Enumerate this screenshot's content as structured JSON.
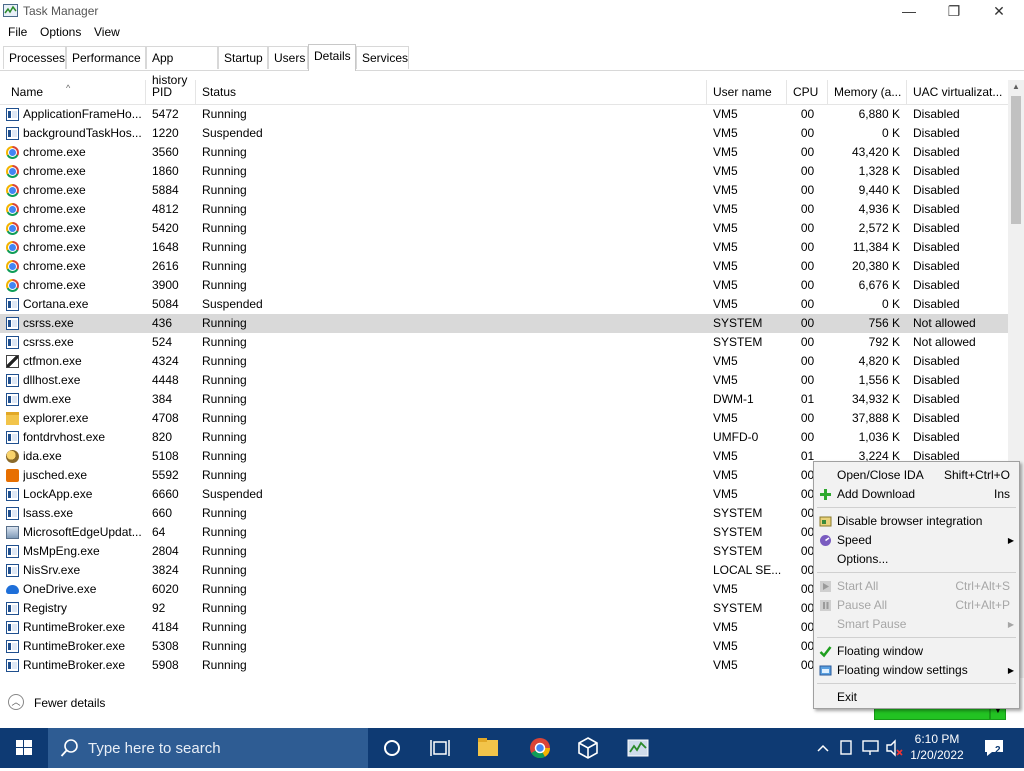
{
  "window": {
    "title": "Task Manager",
    "controls": {
      "minimize": "—",
      "restore": "❐",
      "close": "✕"
    }
  },
  "menu": [
    "File",
    "Options",
    "View"
  ],
  "tabs": [
    "Processes",
    "Performance",
    "App history",
    "Startup",
    "Users",
    "Details",
    "Services"
  ],
  "active_tab": "Details",
  "table": {
    "columns": [
      "Name",
      "PID",
      "Status",
      "User name",
      "CPU",
      "Memory (a...",
      "UAC virtualizat..."
    ],
    "selected_row": 11,
    "rows": [
      {
        "icon": "app-window-icon",
        "name": "ApplicationFrameHo...",
        "pid": "5472",
        "status": "Running",
        "user": "VM5",
        "cpu": "00",
        "mem": "6,880 K",
        "uac": "Disabled"
      },
      {
        "icon": "app-window-icon",
        "name": "backgroundTaskHos...",
        "pid": "1220",
        "status": "Suspended",
        "user": "VM5",
        "cpu": "00",
        "mem": "0 K",
        "uac": "Disabled"
      },
      {
        "icon": "chrome-icon",
        "name": "chrome.exe",
        "pid": "3560",
        "status": "Running",
        "user": "VM5",
        "cpu": "00",
        "mem": "43,420 K",
        "uac": "Disabled"
      },
      {
        "icon": "chrome-icon",
        "name": "chrome.exe",
        "pid": "1860",
        "status": "Running",
        "user": "VM5",
        "cpu": "00",
        "mem": "1,328 K",
        "uac": "Disabled"
      },
      {
        "icon": "chrome-icon",
        "name": "chrome.exe",
        "pid": "5884",
        "status": "Running",
        "user": "VM5",
        "cpu": "00",
        "mem": "9,440 K",
        "uac": "Disabled"
      },
      {
        "icon": "chrome-icon",
        "name": "chrome.exe",
        "pid": "4812",
        "status": "Running",
        "user": "VM5",
        "cpu": "00",
        "mem": "4,936 K",
        "uac": "Disabled"
      },
      {
        "icon": "chrome-icon",
        "name": "chrome.exe",
        "pid": "5420",
        "status": "Running",
        "user": "VM5",
        "cpu": "00",
        "mem": "2,572 K",
        "uac": "Disabled"
      },
      {
        "icon": "chrome-icon",
        "name": "chrome.exe",
        "pid": "1648",
        "status": "Running",
        "user": "VM5",
        "cpu": "00",
        "mem": "11,384 K",
        "uac": "Disabled"
      },
      {
        "icon": "chrome-icon",
        "name": "chrome.exe",
        "pid": "2616",
        "status": "Running",
        "user": "VM5",
        "cpu": "00",
        "mem": "20,380 K",
        "uac": "Disabled"
      },
      {
        "icon": "chrome-icon",
        "name": "chrome.exe",
        "pid": "3900",
        "status": "Running",
        "user": "VM5",
        "cpu": "00",
        "mem": "6,676 K",
        "uac": "Disabled"
      },
      {
        "icon": "app-window-icon",
        "name": "Cortana.exe",
        "pid": "5084",
        "status": "Suspended",
        "user": "VM5",
        "cpu": "00",
        "mem": "0 K",
        "uac": "Disabled"
      },
      {
        "icon": "app-window-icon",
        "name": "csrss.exe",
        "pid": "436",
        "status": "Running",
        "user": "SYSTEM",
        "cpu": "00",
        "mem": "756 K",
        "uac": "Not allowed"
      },
      {
        "icon": "app-window-icon",
        "name": "csrss.exe",
        "pid": "524",
        "status": "Running",
        "user": "SYSTEM",
        "cpu": "00",
        "mem": "792 K",
        "uac": "Not allowed"
      },
      {
        "icon": "pen-icon",
        "name": "ctfmon.exe",
        "pid": "4324",
        "status": "Running",
        "user": "VM5",
        "cpu": "00",
        "mem": "4,820 K",
        "uac": "Disabled"
      },
      {
        "icon": "app-window-icon",
        "name": "dllhost.exe",
        "pid": "4448",
        "status": "Running",
        "user": "VM5",
        "cpu": "00",
        "mem": "1,556 K",
        "uac": "Disabled"
      },
      {
        "icon": "app-window-icon",
        "name": "dwm.exe",
        "pid": "384",
        "status": "Running",
        "user": "DWM-1",
        "cpu": "01",
        "mem": "34,932 K",
        "uac": "Disabled"
      },
      {
        "icon": "folder-icon",
        "name": "explorer.exe",
        "pid": "4708",
        "status": "Running",
        "user": "VM5",
        "cpu": "00",
        "mem": "37,888 K",
        "uac": "Disabled"
      },
      {
        "icon": "app-window-icon",
        "name": "fontdrvhost.exe",
        "pid": "820",
        "status": "Running",
        "user": "UMFD-0",
        "cpu": "00",
        "mem": "1,036 K",
        "uac": "Disabled"
      },
      {
        "icon": "ida-icon",
        "name": "ida.exe",
        "pid": "5108",
        "status": "Running",
        "user": "VM5",
        "cpu": "01",
        "mem": "3,224 K",
        "uac": "Disabled"
      },
      {
        "icon": "java-icon",
        "name": "jusched.exe",
        "pid": "5592",
        "status": "Running",
        "user": "VM5",
        "cpu": "00",
        "mem": "",
        "uac": ""
      },
      {
        "icon": "app-window-icon",
        "name": "LockApp.exe",
        "pid": "6660",
        "status": "Suspended",
        "user": "VM5",
        "cpu": "00",
        "mem": "",
        "uac": ""
      },
      {
        "icon": "app-window-icon",
        "name": "lsass.exe",
        "pid": "660",
        "status": "Running",
        "user": "SYSTEM",
        "cpu": "00",
        "mem": "",
        "uac": ""
      },
      {
        "icon": "edge-update-icon",
        "name": "MicrosoftEdgeUpdat...",
        "pid": "64",
        "status": "Running",
        "user": "SYSTEM",
        "cpu": "00",
        "mem": "",
        "uac": ""
      },
      {
        "icon": "app-window-icon",
        "name": "MsMpEng.exe",
        "pid": "2804",
        "status": "Running",
        "user": "SYSTEM",
        "cpu": "00",
        "mem": "",
        "uac": ""
      },
      {
        "icon": "app-window-icon",
        "name": "NisSrv.exe",
        "pid": "3824",
        "status": "Running",
        "user": "LOCAL SE...",
        "cpu": "00",
        "mem": "",
        "uac": ""
      },
      {
        "icon": "onedrive-icon",
        "name": "OneDrive.exe",
        "pid": "6020",
        "status": "Running",
        "user": "VM5",
        "cpu": "00",
        "mem": "",
        "uac": ""
      },
      {
        "icon": "app-window-icon",
        "name": "Registry",
        "pid": "92",
        "status": "Running",
        "user": "SYSTEM",
        "cpu": "00",
        "mem": "",
        "uac": ""
      },
      {
        "icon": "app-window-icon",
        "name": "RuntimeBroker.exe",
        "pid": "4184",
        "status": "Running",
        "user": "VM5",
        "cpu": "00",
        "mem": "",
        "uac": ""
      },
      {
        "icon": "app-window-icon",
        "name": "RuntimeBroker.exe",
        "pid": "5308",
        "status": "Running",
        "user": "VM5",
        "cpu": "00",
        "mem": "",
        "uac": ""
      },
      {
        "icon": "app-window-icon",
        "name": "RuntimeBroker.exe",
        "pid": "5908",
        "status": "Running",
        "user": "VM5",
        "cpu": "00",
        "mem": "",
        "uac": ""
      }
    ]
  },
  "footer": {
    "fewer_details": "Fewer details"
  },
  "context_menu": {
    "items": [
      {
        "label": "Open/Close IDA",
        "shortcut": "Shift+Ctrl+O",
        "icon": "",
        "disabled": false,
        "submenu": false
      },
      {
        "label": "Add Download",
        "shortcut": "Ins",
        "icon": "add-download-icon",
        "disabled": false,
        "submenu": false
      },
      {
        "separator": true
      },
      {
        "label": "Disable browser integration",
        "shortcut": "",
        "icon": "browser-integration-icon",
        "disabled": false,
        "submenu": false
      },
      {
        "label": "Speed",
        "shortcut": "",
        "icon": "speed-icon",
        "disabled": false,
        "submenu": true
      },
      {
        "label": "Options...",
        "shortcut": "",
        "icon": "",
        "disabled": false,
        "submenu": false
      },
      {
        "separator": true
      },
      {
        "label": "Start All",
        "shortcut": "Ctrl+Alt+S",
        "icon": "start-all-icon",
        "disabled": true,
        "submenu": false
      },
      {
        "label": "Pause All",
        "shortcut": "Ctrl+Alt+P",
        "icon": "pause-all-icon",
        "disabled": true,
        "submenu": false
      },
      {
        "label": "Smart Pause",
        "shortcut": "",
        "icon": "",
        "disabled": true,
        "submenu": true
      },
      {
        "separator": true
      },
      {
        "label": "Floating window",
        "shortcut": "",
        "icon": "checkmark-icon",
        "disabled": false,
        "submenu": false
      },
      {
        "label": "Floating window settings",
        "shortcut": "",
        "icon": "window-settings-icon",
        "disabled": false,
        "submenu": true
      },
      {
        "separator": true
      },
      {
        "label": "Exit",
        "shortcut": "",
        "icon": "",
        "disabled": false,
        "submenu": false
      }
    ]
  },
  "taskbar": {
    "search_placeholder": "Type here to search",
    "pinned": [
      "cortana-icon",
      "task-view-icon",
      "file-explorer-icon",
      "chrome-icon",
      "virtualbox-icon",
      "task-manager-icon"
    ],
    "tray": [
      "show-hidden-icons-icon",
      "tablet-icon",
      "network-icon",
      "volume-muted-icon"
    ],
    "clock_time": "6:10 PM",
    "clock_date": "1/20/2022",
    "notification_count": "2"
  },
  "colors": {
    "taskbar": "#0e3a73",
    "search_box": "#2e5c93",
    "selection": "#d9d9d9",
    "floating_window": "#22c322",
    "accent": "#1f4f8e"
  }
}
